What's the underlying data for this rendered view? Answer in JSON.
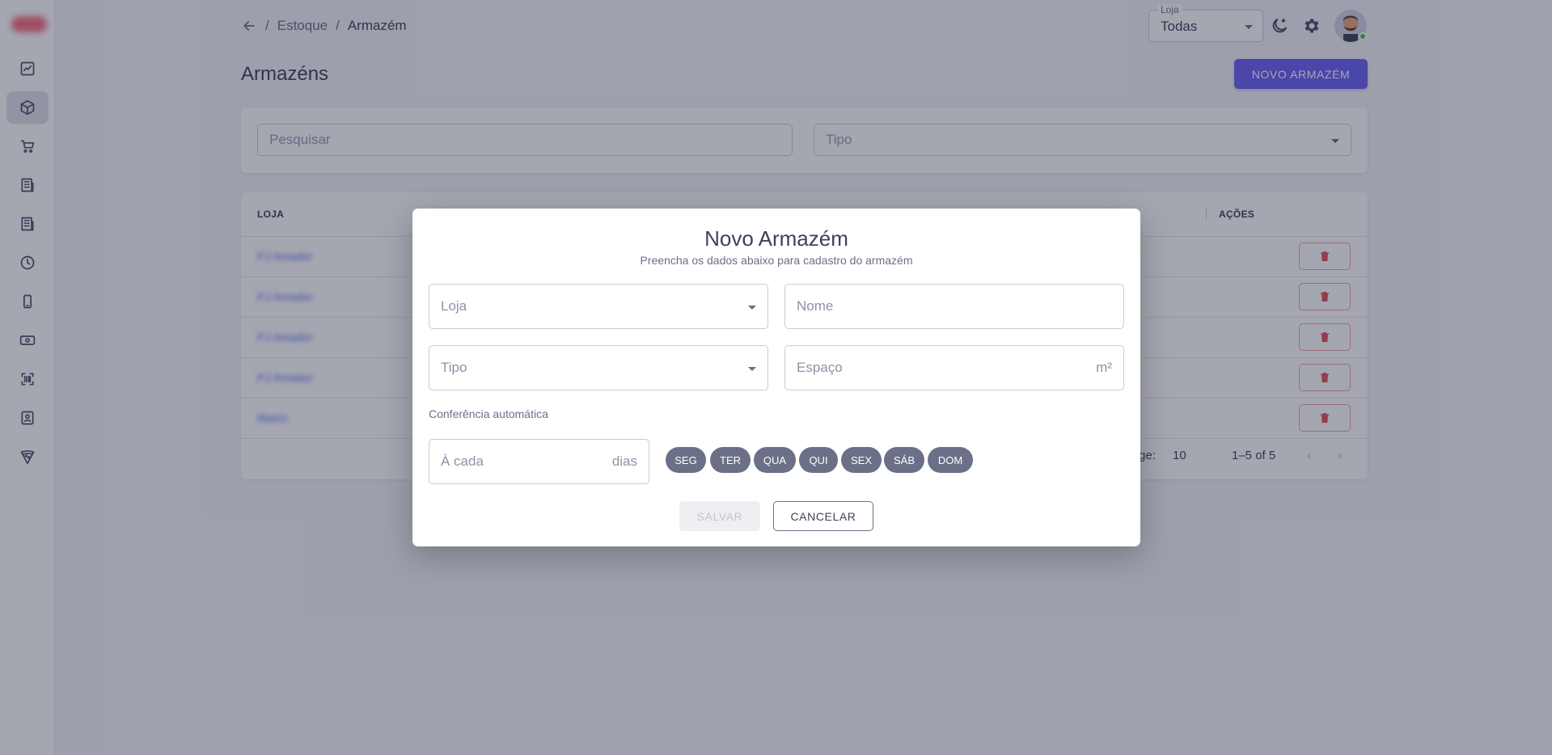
{
  "sidebar": {
    "items": [
      {
        "icon": "chart-line-icon"
      },
      {
        "icon": "package-icon",
        "active": true
      },
      {
        "icon": "cart-icon"
      },
      {
        "icon": "building-icon"
      },
      {
        "icon": "building-icon"
      },
      {
        "icon": "clock-icon"
      },
      {
        "icon": "mobile-icon"
      },
      {
        "icon": "cash-icon"
      },
      {
        "icon": "barcode-scan-icon"
      },
      {
        "icon": "contact-card-icon"
      },
      {
        "icon": "pizza-icon"
      }
    ]
  },
  "header": {
    "breadcrumb": {
      "sep": "/",
      "parent": "Estoque",
      "current": "Armazém"
    },
    "store_select": {
      "label": "Loja",
      "value": "Todas"
    }
  },
  "page": {
    "title": "Armazéns",
    "new_button": "NOVO ARMAZÉM"
  },
  "filters": {
    "search_placeholder": "Pesquisar",
    "type_placeholder": "Tipo"
  },
  "table": {
    "headers": {
      "store": "LOJA",
      "actions": "AÇÕES"
    },
    "rows": [
      {
        "store": "PJ Amador"
      },
      {
        "store": "PJ Amador"
      },
      {
        "store": "PJ Amador"
      },
      {
        "store": "PJ Amador"
      },
      {
        "store": "Matriz"
      }
    ],
    "pagination": {
      "rows_label": "ge:",
      "rows_per_page": "10",
      "range": "1–5 of 5"
    }
  },
  "modal": {
    "title": "Novo Armazém",
    "subtitle": "Preencha os dados abaixo para cadastro do armazém",
    "store_field": "Loja",
    "name_field": "Nome",
    "type_field": "Tipo",
    "space_field": "Espaço",
    "space_unit": "m²",
    "auto_check_label": "Conferência automática",
    "every_field": "À cada",
    "every_unit": "dias",
    "days": [
      "SEG",
      "TER",
      "QUA",
      "QUI",
      "SEX",
      "SÁB",
      "DOM"
    ],
    "save_button": "SALVAR",
    "cancel_button": "CANCELAR"
  }
}
